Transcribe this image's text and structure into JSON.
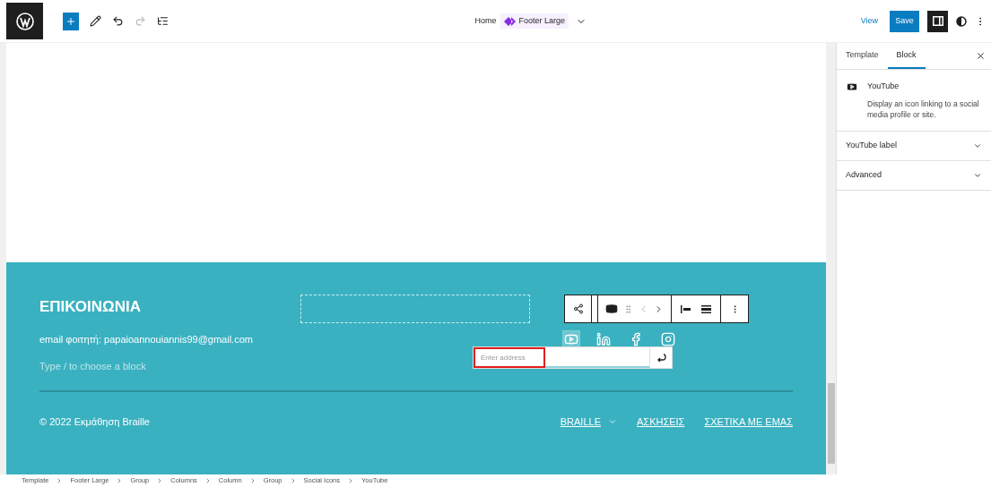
{
  "header": {
    "template_crumb": {
      "home": "Home",
      "current": "Footer Large"
    },
    "view": "View",
    "save": "Save",
    "settings_open": true
  },
  "sidebar": {
    "tabs": [
      {
        "label": "Template",
        "selected": false
      },
      {
        "label": "Block",
        "selected": true
      }
    ],
    "block": {
      "title": "YouTube",
      "description": "Display an icon linking to a social media profile or site."
    },
    "panels": [
      {
        "title": "YouTube label",
        "expanded": false
      },
      {
        "title": "Advanced",
        "expanded": false
      }
    ]
  },
  "footer": {
    "heading": "ΕΠΙΚΟΙΝΩΝΙΑ",
    "email": "email φοιτητή: papaioannouiannis99@gmail.com",
    "appender": "Type / to choose a block",
    "social": [
      {
        "kind": "youtube",
        "selected": true
      },
      {
        "kind": "linkedin",
        "selected": false
      },
      {
        "kind": "facebook",
        "selected": false
      },
      {
        "kind": "instagram",
        "selected": false
      }
    ],
    "address_field": {
      "placeholder": "Enter address"
    },
    "copyright": "© 2022 Εκμάθηση Braille",
    "nav": [
      {
        "label": "BRAILLE",
        "submenu": true
      },
      {
        "label": "ΑΣΚΗΣΕΙΣ",
        "submenu": false
      },
      {
        "label": "ΣΧΕΤΙΚΑ ΜΕ ΕΜΑΣ",
        "submenu": false
      }
    ]
  },
  "breadcrumbs": [
    "Template",
    "Footer Large",
    "Group",
    "Columns",
    "Column",
    "Group",
    "Social Icons",
    "YouTube"
  ]
}
